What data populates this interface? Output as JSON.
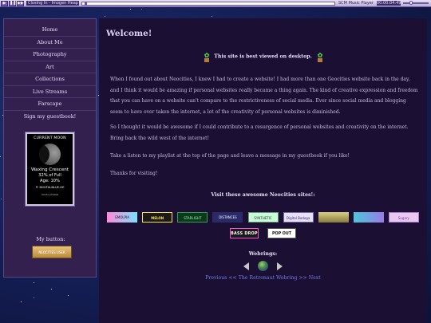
{
  "player": {
    "track": "Closing In - Imogen Heap",
    "label": "SCM Music Player",
    "time": "00:00:04:49",
    "progress": 0.01,
    "volume": 0.3,
    "icons": [
      "play-icon",
      "pause-icon",
      "next-icon"
    ]
  },
  "sidebar": {
    "nav": [
      "Home",
      "About Me",
      "Photography",
      "Art",
      "Collections",
      "Live Streams",
      "Farscape",
      "Sign my guestbook!"
    ],
    "moon": {
      "title": "CURRENT MOON",
      "phase": "Waxing Crescent",
      "full": "32% of Full",
      "age": "Age: 10%",
      "site": "© DIGITALBLUE.HE",
      "footer": "lunar phase"
    },
    "my_button_label": "My button:",
    "my_button_text": "NEOCITIES USER"
  },
  "main": {
    "title": "Welcome!",
    "best_viewed": "This site is best viewed on desktop.",
    "paragraphs": [
      "When I found out about Neocities, I knew I had to create a website! I had more than one Geocities website back in the day, and I think it would be amazing if personal websites really became a thing again. The kind of creative expression and freedom that you can have on a website can't compare to the restrictiveness of social media. Ever since social media and blogging seem to have over taken the internet, a lot of the creativity of personal websites is diminished.",
      "So I thought it would be awesome if I could contribute to a resurgence of personal websites and creativity on the internet. Bring back the wild west of the internet!",
      "Take a listen to my playlist at the top of the page and leave a message in my guestbook if you like!",
      "Thanks for visiting!"
    ],
    "visit_title": "Visit these awesome Neocities sites!:",
    "badges_row1": [
      "EMOLPIA",
      "MELON",
      "STARLIGHT",
      "DISTANCES",
      "SYNTHETIC",
      "Digital Bodega",
      "",
      "",
      "Sugary"
    ],
    "badges_row2": [
      "BASS DROP",
      "POP OUT"
    ],
    "webrings_title": "Webrings:",
    "ring_prev": "Previous",
    "ring_sep1": "<<",
    "ring_name": "The Retronaut Webring",
    "ring_sep2": ">>",
    "ring_next": "Next"
  },
  "colors": {
    "background": "#16215a",
    "sidebar": "#33204f",
    "content": "#1b0f33",
    "link": "#6f7ee8"
  }
}
